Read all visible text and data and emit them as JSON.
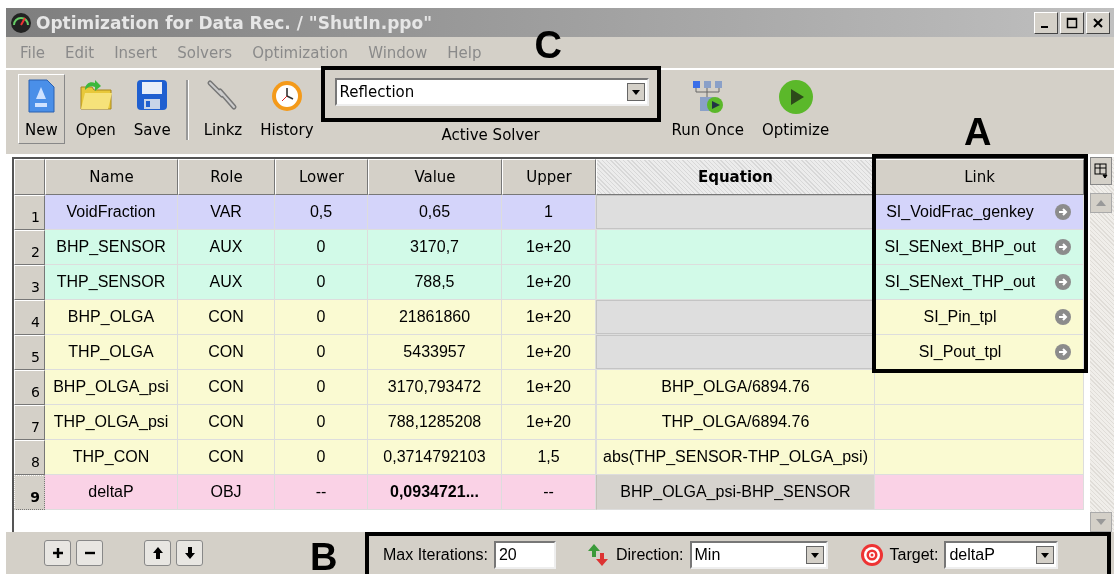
{
  "window": {
    "title": "Optimization for Data Rec. / \"ShutIn.ppo\""
  },
  "menu": [
    "File",
    "Edit",
    "Insert",
    "Solvers",
    "Optimization",
    "Window",
    "Help"
  ],
  "toolbar_left": [
    {
      "label": "New",
      "kind": "new",
      "pressed": true
    },
    {
      "label": "Open",
      "kind": "open",
      "pressed": false
    },
    {
      "label": "Save",
      "kind": "save",
      "pressed": false
    }
  ],
  "toolbar_mid": [
    {
      "label": "Linkz",
      "kind": "links",
      "pressed": false
    },
    {
      "label": "History",
      "kind": "history",
      "pressed": false
    }
  ],
  "solver": {
    "value": "Reflection",
    "caption": "Active Solver",
    "annotation": "C"
  },
  "toolbar_right": [
    {
      "label": "Run Once",
      "kind": "run_once",
      "pressed": false
    },
    {
      "label": "Optimize",
      "kind": "optimize",
      "pressed": false
    }
  ],
  "table": {
    "annotation": "A",
    "columns": [
      {
        "label": "Name",
        "emphasized": false
      },
      {
        "label": "Role",
        "emphasized": false
      },
      {
        "label": "Lower",
        "emphasized": false
      },
      {
        "label": "Value",
        "emphasized": false
      },
      {
        "label": "Upper",
        "emphasized": false
      },
      {
        "label": "Equation",
        "emphasized": true
      },
      {
        "label": "Link",
        "emphasized": false
      }
    ],
    "rows": [
      {
        "number": "1",
        "name": "VoidFraction",
        "role": "VAR",
        "lower": "0,5",
        "value": "0,65",
        "upper": "1",
        "link": "SI_VoidFrac_genkey",
        "color": "#d4d4fa",
        "equation_locked": true,
        "selected": false
      },
      {
        "number": "2",
        "name": "BHP_SENSOR",
        "role": "AUX",
        "lower": "0",
        "value": "3170,7",
        "upper": "1e+20",
        "link": "SI_SENext_BHP_out",
        "color": "#d2fae8",
        "equation_locked": false,
        "selected": false
      },
      {
        "number": "3",
        "name": "THP_SENSOR",
        "role": "AUX",
        "lower": "0",
        "value": "788,5",
        "upper": "1e+20",
        "link": "SI_SENext_THP_out",
        "color": "#d2fae8",
        "equation_locked": false,
        "selected": false
      },
      {
        "number": "4",
        "name": "BHP_OLGA",
        "role": "CON",
        "lower": "0",
        "value": "21861860",
        "upper": "1e+20",
        "link": "SI_Pin_tpl",
        "color": "#fafad2",
        "equation_locked": true,
        "selected": false
      },
      {
        "number": "5",
        "name": "THP_OLGA",
        "role": "CON",
        "lower": "0",
        "value": "5433957",
        "upper": "1e+20",
        "link": "SI_Pout_tpl",
        "color": "#fafad2",
        "equation_locked": true,
        "selected": false
      },
      {
        "number": "6",
        "name": "BHP_OLGA_psi",
        "role": "CON",
        "lower": "0",
        "value": "3170,793472",
        "upper": "1e+20",
        "equation": "BHP_OLGA/6894.76",
        "color": "#fafad2",
        "equation_locked": false,
        "selected": false
      },
      {
        "number": "7",
        "name": "THP_OLGA_psi",
        "role": "CON",
        "lower": "0",
        "value": "788,1285208",
        "upper": "1e+20",
        "equation": "THP_OLGA/6894.76",
        "color": "#fafad2",
        "equation_locked": false,
        "selected": false
      },
      {
        "number": "8",
        "name": "THP_CON",
        "role": "CON",
        "lower": "0",
        "value": "0,3714792103",
        "upper": "1,5",
        "equation": "abs(THP_SENSOR-THP_OLGA_psi)",
        "color": "#fafad2",
        "equation_locked": false,
        "selected": false
      },
      {
        "number": "9",
        "name": "deltaP",
        "role": "OBJ",
        "lower": "--",
        "value": "0,0934721...",
        "upper": "--",
        "equation": "BHP_OLGA_psi-BHP_SENSOR",
        "color": "#fad2e6",
        "equation_locked": true,
        "selected": true
      }
    ]
  },
  "settings": {
    "annotation": "B",
    "max_iterations": {
      "label": "Max Iterations:",
      "value": "20"
    },
    "direction": {
      "label": "Direction:",
      "value": "Min"
    },
    "target": {
      "label": "Target:",
      "value": "deltaP"
    }
  }
}
